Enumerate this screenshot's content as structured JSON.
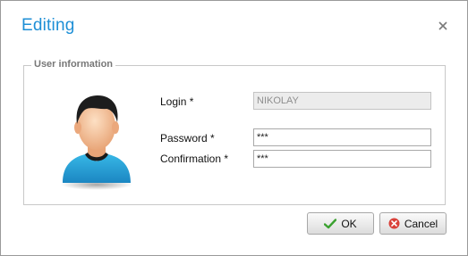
{
  "dialog": {
    "title": "Editing",
    "close_glyph": "×"
  },
  "group": {
    "legend": "User information"
  },
  "avatar": {
    "icon": "user-avatar-icon"
  },
  "form": {
    "login_label": "Login *",
    "login_value": "NIKOLAY",
    "password_label": "Password *",
    "password_value": "***",
    "confirmation_label": "Confirmation *",
    "confirmation_value": "***"
  },
  "buttons": {
    "ok_label": "OK",
    "ok_icon": "checkmark-icon",
    "cancel_label": "Cancel",
    "cancel_icon": "cancel-icon"
  },
  "colors": {
    "title": "#1e8fd6",
    "ok_check": "#3aa12f",
    "cancel_circle": "#d9413a"
  }
}
